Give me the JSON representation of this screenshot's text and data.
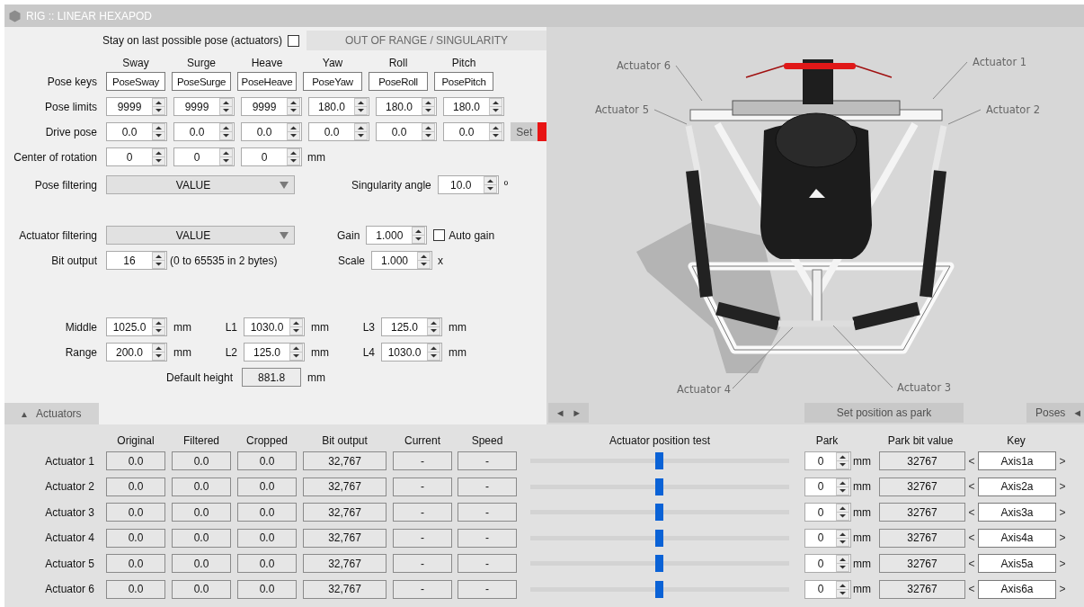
{
  "window": {
    "title": "RIG :: LINEAR HEXAPOD"
  },
  "stay_on_last_pose": {
    "label": "Stay on last possible pose (actuators)",
    "checked": false
  },
  "status_banner": {
    "text": "OUT OF RANGE / SINGULARITY",
    "active": false
  },
  "axes": [
    "Sway",
    "Surge",
    "Heave",
    "Yaw",
    "Roll",
    "Pitch"
  ],
  "pose_rows": [
    {
      "label": "Pose keys",
      "kind": "text",
      "values": [
        "PoseSway",
        "PoseSurge",
        "PoseHeave",
        "PoseYaw",
        "PoseRoll",
        "PosePitch"
      ]
    },
    {
      "label": "Pose limits",
      "kind": "spin",
      "values": [
        "9999",
        "9999",
        "9999",
        "180.0",
        "180.0",
        "180.0"
      ]
    },
    {
      "label": "Drive pose",
      "kind": "spin",
      "values": [
        "0.0",
        "0.0",
        "0.0",
        "0.0",
        "0.0",
        "0.0"
      ],
      "action": "Set",
      "action_disabled": true,
      "warning": true
    },
    {
      "label": "Center of rotation",
      "kind": "spin",
      "values": [
        "0",
        "0",
        "0"
      ],
      "unit": "mm"
    }
  ],
  "pose_filtering": {
    "label": "Pose filtering",
    "value": "VALUE"
  },
  "singularity_angle": {
    "label": "Singularity angle",
    "value": "10.0",
    "unit": "º"
  },
  "actuator_filtering": {
    "label": "Actuator filtering",
    "value": "VALUE"
  },
  "gain": {
    "label": "Gain",
    "value": "1.000"
  },
  "auto_gain": {
    "label": "Auto gain",
    "checked": false
  },
  "bit_output": {
    "label": "Bit output",
    "value": "16",
    "note": "(0 to 65535 in 2 bytes)"
  },
  "scale": {
    "label": "Scale",
    "value": "1.000",
    "unit": "x"
  },
  "geometry_rows": [
    {
      "fields": [
        {
          "label": "Middle",
          "value": "1025.0",
          "unit": "mm"
        },
        {
          "label": "L1",
          "value": "1030.0",
          "unit": "mm"
        },
        {
          "label": "L3",
          "value": "125.0",
          "unit": "mm"
        }
      ]
    },
    {
      "fields": [
        {
          "label": "Range",
          "value": "200.0",
          "unit": "mm"
        },
        {
          "label": "L2",
          "value": "125.0",
          "unit": "mm"
        },
        {
          "label": "L4",
          "value": "1030.0",
          "unit": "mm"
        }
      ]
    }
  ],
  "default_height": {
    "label": "Default height",
    "value": "881.8",
    "unit": "mm"
  },
  "diagram": {
    "labels": [
      "Actuator 1",
      "Actuator 2",
      "Actuator 3",
      "Actuator 4",
      "Actuator 5",
      "Actuator 6"
    ]
  },
  "actuators_tab": {
    "arrow": "▲",
    "label": "Actuators"
  },
  "view_nav": {
    "prev": "◄",
    "next": "►"
  },
  "set_park_button": {
    "label": "Set position as park"
  },
  "poses_tab": {
    "label": "Poses",
    "arrow": "◄"
  },
  "actuator_table": {
    "columns": [
      "Original",
      "Filtered",
      "Cropped",
      "Bit output",
      "Current",
      "Speed"
    ],
    "test_label": "Actuator position test",
    "park_columns": [
      "Park",
      "Park bit value",
      "Key"
    ],
    "rows": [
      {
        "name": "Actuator 1",
        "original": "0.0",
        "filtered": "0.0",
        "cropped": "0.0",
        "bit_output": "32,767",
        "current": "-",
        "speed": "-",
        "level": 0.5,
        "park": "0",
        "park_unit": "mm",
        "park_bit": "32767",
        "prev": "<",
        "key": "Axis1a",
        "next": ">"
      },
      {
        "name": "Actuator 2",
        "original": "0.0",
        "filtered": "0.0",
        "cropped": "0.0",
        "bit_output": "32,767",
        "current": "-",
        "speed": "-",
        "level": 0.5,
        "park": "0",
        "park_unit": "mm",
        "park_bit": "32767",
        "prev": "<",
        "key": "Axis2a",
        "next": ">"
      },
      {
        "name": "Actuator 3",
        "original": "0.0",
        "filtered": "0.0",
        "cropped": "0.0",
        "bit_output": "32,767",
        "current": "-",
        "speed": "-",
        "level": 0.5,
        "park": "0",
        "park_unit": "mm",
        "park_bit": "32767",
        "prev": "<",
        "key": "Axis3a",
        "next": ">"
      },
      {
        "name": "Actuator 4",
        "original": "0.0",
        "filtered": "0.0",
        "cropped": "0.0",
        "bit_output": "32,767",
        "current": "-",
        "speed": "-",
        "level": 0.5,
        "park": "0",
        "park_unit": "mm",
        "park_bit": "32767",
        "prev": "<",
        "key": "Axis4a",
        "next": ">"
      },
      {
        "name": "Actuator 5",
        "original": "0.0",
        "filtered": "0.0",
        "cropped": "0.0",
        "bit_output": "32,767",
        "current": "-",
        "speed": "-",
        "level": 0.5,
        "park": "0",
        "park_unit": "mm",
        "park_bit": "32767",
        "prev": "<",
        "key": "Axis5a",
        "next": ">"
      },
      {
        "name": "Actuator 6",
        "original": "0.0",
        "filtered": "0.0",
        "cropped": "0.0",
        "bit_output": "32,767",
        "current": "-",
        "speed": "-",
        "level": 0.5,
        "park": "0",
        "park_unit": "mm",
        "park_bit": "32767",
        "prev": "<",
        "key": "Axis6a",
        "next": ">"
      }
    ]
  }
}
